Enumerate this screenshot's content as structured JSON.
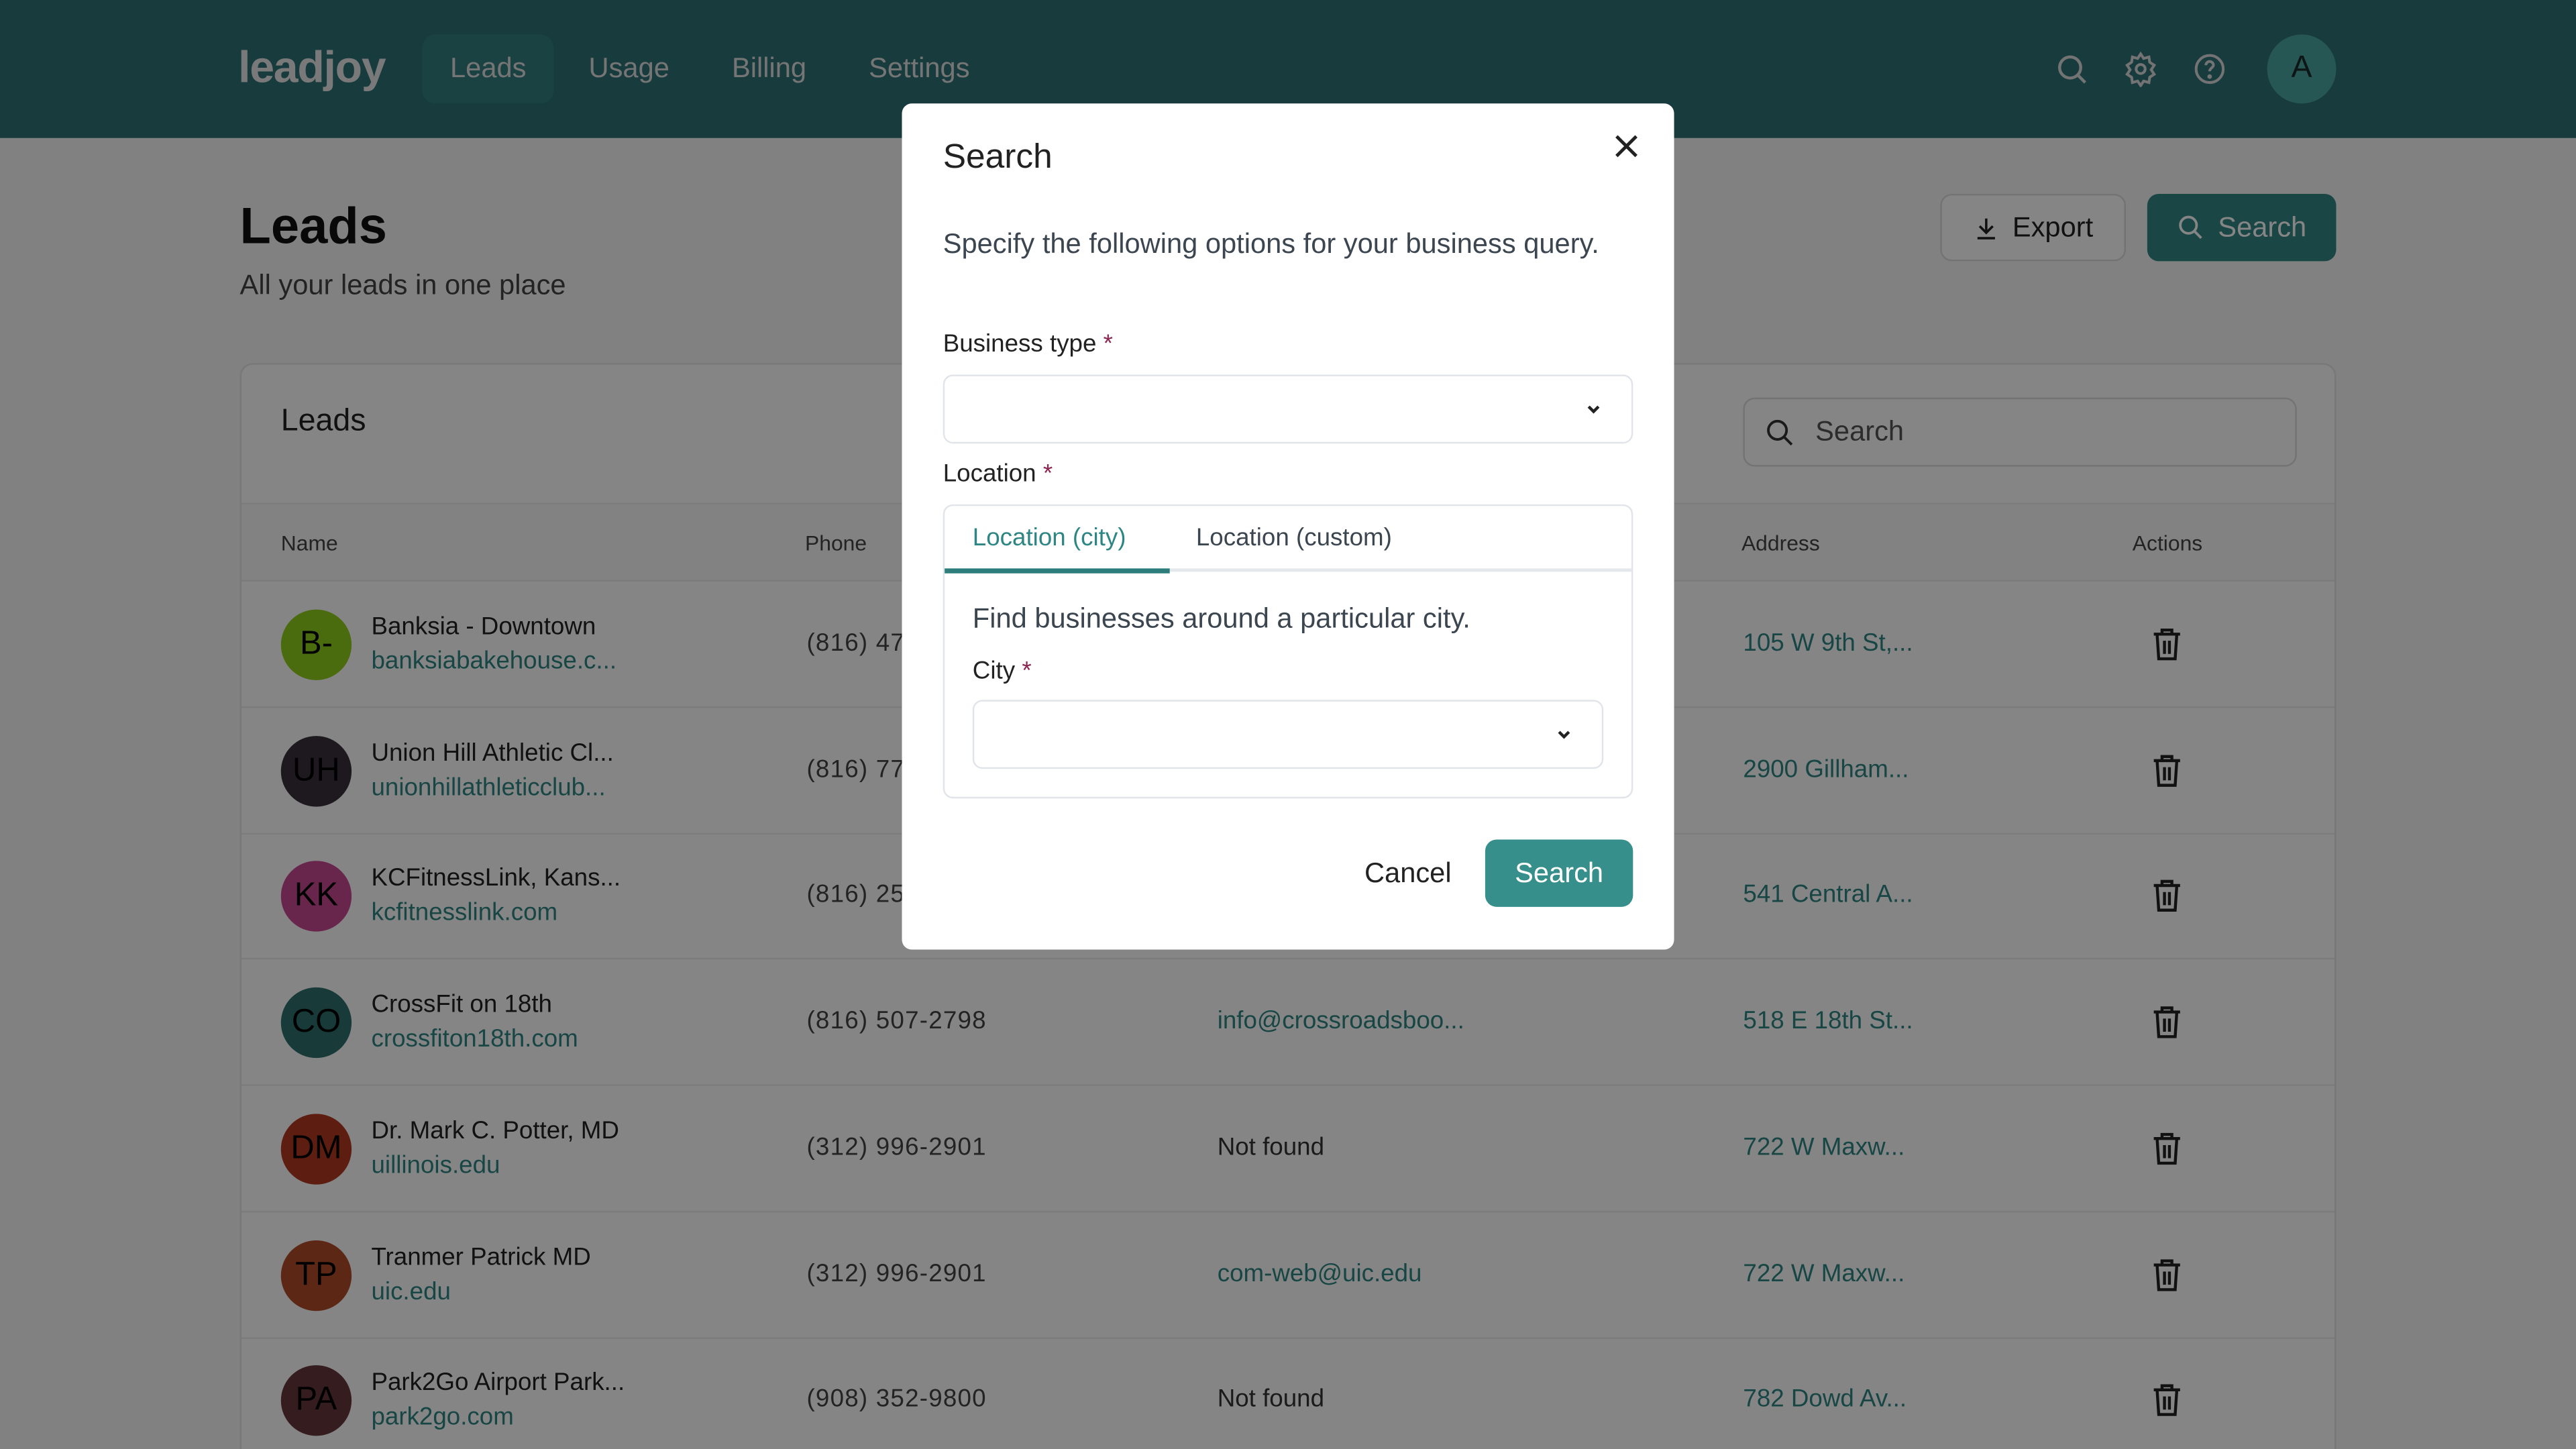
{
  "app": {
    "logo": "leadjoy"
  },
  "nav": {
    "items": [
      {
        "label": "Leads",
        "active": true
      },
      {
        "label": "Usage"
      },
      {
        "label": "Billing"
      },
      {
        "label": "Settings"
      }
    ]
  },
  "header_icons": [
    "search-icon",
    "gear-icon",
    "help-icon"
  ],
  "user": {
    "avatar_initial": "A"
  },
  "page": {
    "title": "Leads",
    "subtitle": "All your leads in one place",
    "export_label": "Export",
    "search_label": "Search"
  },
  "table": {
    "title": "Leads",
    "search_placeholder": "Search",
    "columns": {
      "name": "Name",
      "phone": "Phone",
      "address": "Address",
      "actions": "Actions"
    },
    "rows": [
      {
        "initials": "B-",
        "color": "#8fcd1c",
        "name": "Banksia - Downtown",
        "website": "banksiabakehouse.c...",
        "phone": "(816) 47",
        "email": "",
        "address": "105 W 9th St,..."
      },
      {
        "initials": "UH",
        "color": "#3a2f3d",
        "name": "Union Hill Athletic Cl...",
        "website": "unionhillathleticclub...",
        "phone": "(816) 77",
        "email": "",
        "address": "2900 Gillham..."
      },
      {
        "initials": "KK",
        "color": "#c94a95",
        "name": "KCFitnessLink, Kans...",
        "website": "kcfitnesslink.com",
        "phone": "(816) 25",
        "email": "",
        "address": "541 Central A..."
      },
      {
        "initials": "CO",
        "color": "#2e6f6e",
        "name": "CrossFit on 18th",
        "website": "crossfiton18th.com",
        "phone": "(816) 507-2798",
        "email": "info@crossroadsboo...",
        "address": "518 E 18th St..."
      },
      {
        "initials": "DM",
        "color": "#b23a22",
        "name": "Dr. Mark C. Potter, MD",
        "website": "uillinois.edu",
        "phone": "(312) 996-2901",
        "email": "Not found",
        "address": "722 W Maxw..."
      },
      {
        "initials": "TP",
        "color": "#b04e2a",
        "name": "Tranmer Patrick MD",
        "website": "uic.edu",
        "phone": "(312) 996-2901",
        "email": "com-web@uic.edu",
        "address": "722 W Maxw..."
      },
      {
        "initials": "PA",
        "color": "#66363a",
        "name": "Park2Go Airport Park...",
        "website": "park2go.com",
        "phone": "(908) 352-9800",
        "email": "Not found",
        "address": "782 Dowd Av..."
      }
    ]
  },
  "modal": {
    "title": "Search",
    "description": "Specify the following options for your business query.",
    "business_type_label": "Business type",
    "business_type_value": "",
    "location_label": "Location",
    "required_mark": "*",
    "tabs": [
      {
        "label": "Location (city)",
        "active": true
      },
      {
        "label": "Location (custom)"
      }
    ],
    "tab_description": "Find businesses around a particular city.",
    "city_label": "City",
    "city_value": "",
    "cancel_label": "Cancel",
    "search_label": "Search"
  },
  "colors": {
    "brand": "#2e7377",
    "accent": "#338985",
    "required": "#8b2451"
  }
}
